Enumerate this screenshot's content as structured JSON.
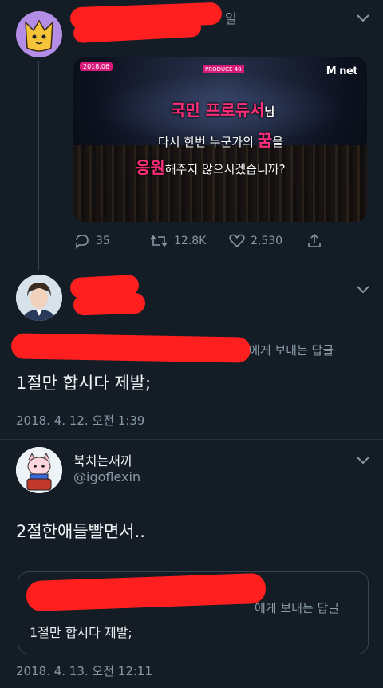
{
  "tweet1": {
    "header_suffix": "일",
    "media": {
      "program_tag": "2018.06",
      "small_tag": "PRODUCE 48",
      "small_tag2": "",
      "channel_logo": "M net",
      "caption_line1_main": "국민 프로듀서",
      "caption_line1_suffix": "님",
      "caption_line2_pre": "다시 한번 누군가의 ",
      "caption_line2_em": "꿈",
      "caption_line2_post": "을",
      "caption_line3_em": "응원",
      "caption_line3_post": "해주지 않으시겠습니까?"
    },
    "actions": {
      "replies": "35",
      "retweets": "12.8K",
      "likes": "2,530"
    },
    "icons": [
      "reply-icon",
      "retweet-icon",
      "like-icon",
      "share-icon"
    ]
  },
  "tweet2": {
    "reply_to_suffix": "에게 보내는 답글",
    "text": "1절만 합시다 제발;",
    "timestamp": "2018. 4. 12. 오전 1:39"
  },
  "tweet3": {
    "display_name": "북치는새끼",
    "handle": "@igoflexin",
    "text": "2절한애들빨면서..",
    "quote": {
      "reply_to_suffix": "에게 보내는 답글",
      "text": "1절만 합시다 제발;"
    },
    "timestamp": "2018. 4. 13. 오전 12:11"
  },
  "colors": {
    "background": "#141d26",
    "redaction": "#ff1f1f",
    "muted": "#8899a6",
    "accent_pink": "#ff2e7a"
  }
}
